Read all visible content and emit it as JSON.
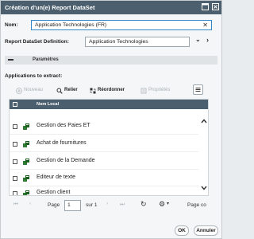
{
  "window": {
    "title": "Création d'un(e) Report DataSet",
    "icons": [
      "restore-icon",
      "close-icon"
    ]
  },
  "form": {
    "nom_label": "Nom:",
    "nom_value": "Application Technologies (FR)",
    "definition_label": "Report DataSet Definition:",
    "definition_value": "Application Technologies"
  },
  "section": {
    "title": "Paramètres"
  },
  "apps": {
    "label": "Applications to extract:",
    "toolbar": {
      "nouveau": "Nouveau",
      "relier": "Relier",
      "reordonner": "Réordonner",
      "proprietes": "Propriétés"
    },
    "column_header": "Nom Local",
    "rows": [
      {
        "name": "Gestion des Paies ET"
      },
      {
        "name": "Achat de fournitures"
      },
      {
        "name": "Gestion de la Demande"
      },
      {
        "name": "Editeur de texte"
      },
      {
        "name": "Gestion client"
      }
    ]
  },
  "pager": {
    "page_label": "Page",
    "page_value": "1",
    "of_label": "sur 1",
    "cut_label": "Page co"
  },
  "buttons": {
    "ok": "OK",
    "cancel": "Annuler"
  },
  "colors": {
    "titlebar": "#4b5f6e",
    "accent": "#2f86c8",
    "doc_icon": "#2e7d32"
  }
}
